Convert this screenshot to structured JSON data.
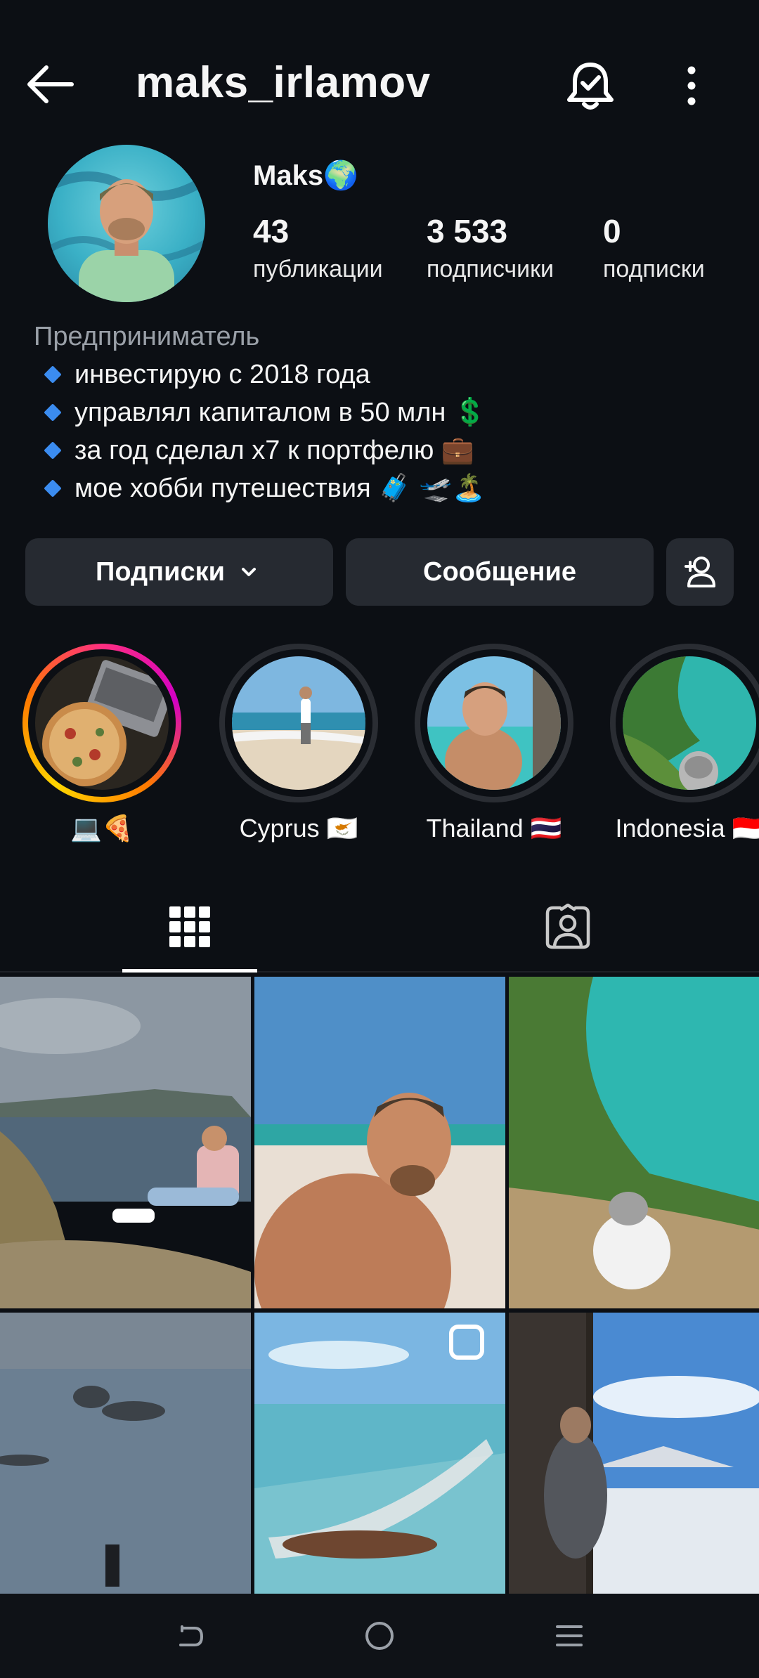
{
  "header": {
    "username": "maks_irlamov"
  },
  "profile": {
    "display_name": "Maks🌍",
    "stats": [
      {
        "value": "43",
        "label": "публикации"
      },
      {
        "value": "3 533",
        "label": "подписчики"
      },
      {
        "value": "0",
        "label": "подписки"
      }
    ],
    "bio": {
      "category": "Предприниматель",
      "lines": [
        "инвестирую с 2018 года",
        "управлял капиталом в 50 млн 💲",
        "за год сделал х7 к портфелю 💼",
        "мое хобби путешествия 🧳 🛫🏝️"
      ]
    }
  },
  "actions": {
    "following_label": "Подписки",
    "message_label": "Сообщение"
  },
  "highlights": [
    {
      "label": "💻🍕"
    },
    {
      "label": "Cyprus 🇨🇾"
    },
    {
      "label": "Thailand 🇹🇭"
    },
    {
      "label": "Indonesia 🇮🇩"
    }
  ],
  "tabs": {
    "active": "grid",
    "items": [
      "grid-icon",
      "tagged-icon"
    ]
  },
  "colors": {
    "background": "#0c0f14",
    "button": "#262a31",
    "accent_blue": "#3b8cf0",
    "muted_text": "#9aa0a8"
  }
}
